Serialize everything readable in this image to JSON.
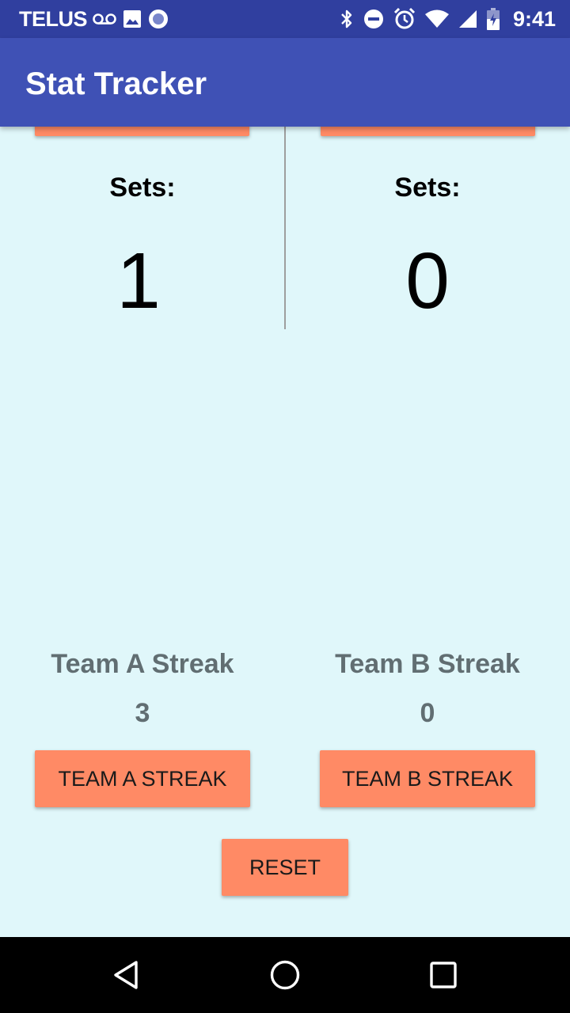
{
  "status_bar": {
    "carrier": "TELUS",
    "time": "9:41",
    "left_icons": [
      "voicemail-icon",
      "image-icon",
      "record-icon"
    ],
    "right_icons": [
      "bluetooth-icon",
      "do-not-disturb-icon",
      "alarm-icon",
      "wifi-icon",
      "signal-icon",
      "battery-icon"
    ]
  },
  "app_bar": {
    "title": "Stat Tracker"
  },
  "team_a": {
    "sets_label": "Sets:",
    "sets_value": "1",
    "streak_label": "Team A Streak",
    "streak_value": "3",
    "streak_button": "TEAM A STREAK"
  },
  "team_b": {
    "sets_label": "Sets:",
    "sets_value": "0",
    "streak_label": "Team B Streak",
    "streak_value": "0",
    "streak_button": "TEAM B STREAK"
  },
  "reset_button": "RESET",
  "nav_bar": {
    "icons": [
      "back-icon",
      "home-icon",
      "recents-icon"
    ]
  },
  "colors": {
    "status_bar": "#303F9F",
    "app_bar": "#3F51B5",
    "background": "#E0F7FA",
    "button": "#FF8A65",
    "streak_text": "#616E72"
  }
}
